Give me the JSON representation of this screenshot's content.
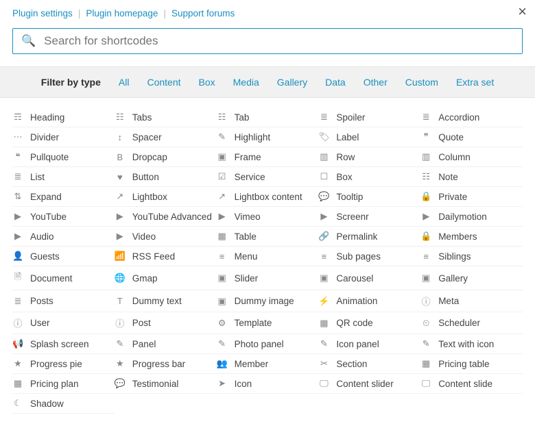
{
  "links": {
    "settings": "Plugin settings",
    "homepage": "Plugin homepage",
    "forums": "Support forums"
  },
  "close_glyph": "×",
  "search": {
    "placeholder": "Search for shortcodes"
  },
  "filter": {
    "label": "Filter by type",
    "items": [
      "All",
      "Content",
      "Box",
      "Media",
      "Gallery",
      "Data",
      "Other",
      "Custom",
      "Extra set"
    ]
  },
  "shortcodes": [
    {
      "label": "Heading",
      "icon": "☶"
    },
    {
      "label": "Tabs",
      "icon": "☷"
    },
    {
      "label": "Tab",
      "icon": "☷"
    },
    {
      "label": "Spoiler",
      "icon": "≣"
    },
    {
      "label": "Accordion",
      "icon": "≣"
    },
    {
      "label": "Divider",
      "icon": "⋯"
    },
    {
      "label": "Spacer",
      "icon": "↕"
    },
    {
      "label": "Highlight",
      "icon": "✎"
    },
    {
      "label": "Label",
      "icon": "🏷"
    },
    {
      "label": "Quote",
      "icon": "❞"
    },
    {
      "label": "Pullquote",
      "icon": "❝"
    },
    {
      "label": "Dropcap",
      "icon": "B"
    },
    {
      "label": "Frame",
      "icon": "▣"
    },
    {
      "label": "Row",
      "icon": "▥"
    },
    {
      "label": "Column",
      "icon": "▥"
    },
    {
      "label": "List",
      "icon": "≣"
    },
    {
      "label": "Button",
      "icon": "♥"
    },
    {
      "label": "Service",
      "icon": "☑"
    },
    {
      "label": "Box",
      "icon": "☐"
    },
    {
      "label": "Note",
      "icon": "☷"
    },
    {
      "label": "Expand",
      "icon": "⇅"
    },
    {
      "label": "Lightbox",
      "icon": "↗"
    },
    {
      "label": "Lightbox content",
      "icon": "↗"
    },
    {
      "label": "Tooltip",
      "icon": "💬"
    },
    {
      "label": "Private",
      "icon": "🔒"
    },
    {
      "label": "YouTube",
      "icon": "▶"
    },
    {
      "label": "YouTube Advanced",
      "icon": "▶"
    },
    {
      "label": "Vimeo",
      "icon": "▶"
    },
    {
      "label": "Screenr",
      "icon": "▶"
    },
    {
      "label": "Dailymotion",
      "icon": "▶"
    },
    {
      "label": "Audio",
      "icon": "▶"
    },
    {
      "label": "Video",
      "icon": "▶"
    },
    {
      "label": "Table",
      "icon": "▦"
    },
    {
      "label": "Permalink",
      "icon": "🔗"
    },
    {
      "label": "Members",
      "icon": "🔒"
    },
    {
      "label": "Guests",
      "icon": "👤"
    },
    {
      "label": "RSS Feed",
      "icon": "📶"
    },
    {
      "label": "Menu",
      "icon": "≡"
    },
    {
      "label": "Sub pages",
      "icon": "≡"
    },
    {
      "label": "Siblings",
      "icon": "≡"
    },
    {
      "label": "Document",
      "icon": "🗎"
    },
    {
      "label": "Gmap",
      "icon": "🌐"
    },
    {
      "label": "Slider",
      "icon": "▣"
    },
    {
      "label": "Carousel",
      "icon": "▣"
    },
    {
      "label": "Gallery",
      "icon": "▣"
    },
    {
      "label": "Posts",
      "icon": "≣"
    },
    {
      "label": "Dummy text",
      "icon": "T"
    },
    {
      "label": "Dummy image",
      "icon": "▣"
    },
    {
      "label": "Animation",
      "icon": "⚡"
    },
    {
      "label": "Meta",
      "icon": "ⓘ"
    },
    {
      "label": "User",
      "icon": "ⓘ"
    },
    {
      "label": "Post",
      "icon": "ⓘ"
    },
    {
      "label": "Template",
      "icon": "⚙"
    },
    {
      "label": "QR code",
      "icon": "▦"
    },
    {
      "label": "Scheduler",
      "icon": "⏲"
    },
    {
      "label": "Splash screen",
      "icon": "📢"
    },
    {
      "label": "Panel",
      "icon": "✎"
    },
    {
      "label": "Photo panel",
      "icon": "✎"
    },
    {
      "label": "Icon panel",
      "icon": "✎"
    },
    {
      "label": "Text with icon",
      "icon": "✎"
    },
    {
      "label": "Progress pie",
      "icon": "★"
    },
    {
      "label": "Progress bar",
      "icon": "★"
    },
    {
      "label": "Member",
      "icon": "👥"
    },
    {
      "label": "Section",
      "icon": "✂"
    },
    {
      "label": "Pricing table",
      "icon": "▦"
    },
    {
      "label": "Pricing plan",
      "icon": "▦"
    },
    {
      "label": "Testimonial",
      "icon": "💬"
    },
    {
      "label": "Icon",
      "icon": "➤"
    },
    {
      "label": "Content slider",
      "icon": "🖵"
    },
    {
      "label": "Content slide",
      "icon": "🖵"
    },
    {
      "label": "Shadow",
      "icon": "☾"
    }
  ]
}
